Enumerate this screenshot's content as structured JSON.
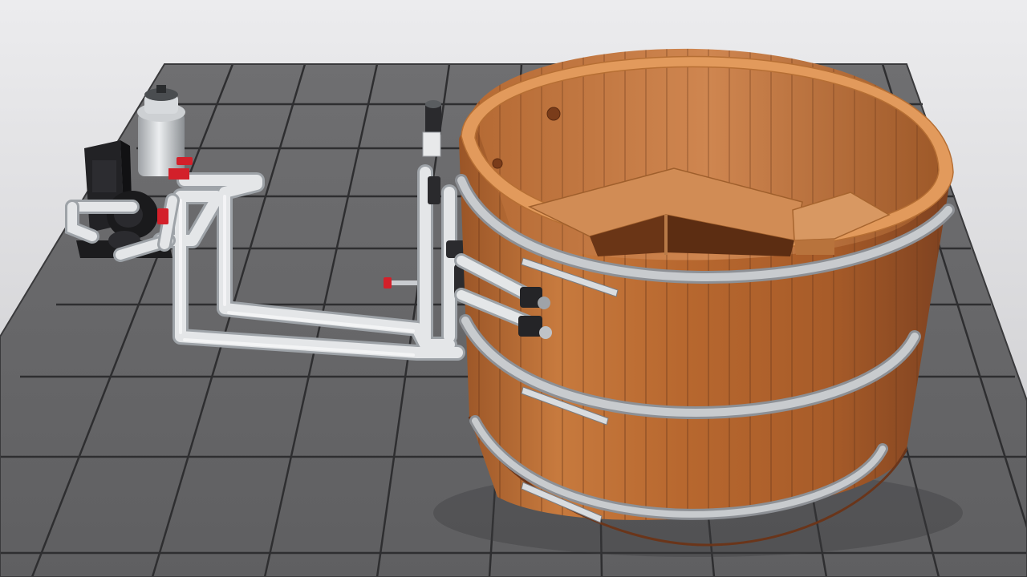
{
  "scene": {
    "subject": "wooden-hot-tub-with-external-pump-and-filter",
    "colors": {
      "background_top": "#ececee",
      "background_bottom": "#c9c9cc",
      "tile": "#6d6d6f",
      "tile_dark": "#555557",
      "grout": "#2e2e30",
      "wood_light": "#d58a4f",
      "wood_mid": "#b86a33",
      "wood_dark": "#8a4a22",
      "wood_inner": "#c47a44",
      "rim": "#e29a5c",
      "band": "#b9bcc0",
      "band_shadow": "#8d9095",
      "pipe": "#e4e6e8",
      "pipe_shadow": "#a9adb2",
      "valve_red": "#d3202a",
      "pump_black": "#1c1c1e"
    },
    "icons": [
      "pump-icon",
      "filter-icon",
      "valve-icon",
      "jet-icon"
    ]
  }
}
